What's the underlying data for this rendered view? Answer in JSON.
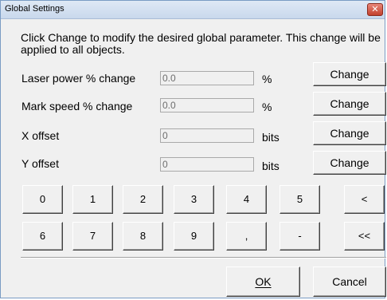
{
  "window": {
    "title": "Global Settings",
    "close_symbol": "✕"
  },
  "instructions": "Click Change to modify the desired global parameter. This change will be applied to all objects.",
  "parameters": [
    {
      "label": "Laser power % change",
      "value": "0.0",
      "unit": "%",
      "button": "Change"
    },
    {
      "label": "Mark speed % change",
      "value": "0.0",
      "unit": "%",
      "button": "Change"
    },
    {
      "label": "X offset",
      "value": "0",
      "unit": "bits",
      "button": "Change"
    },
    {
      "label": "Y offset",
      "value": "0",
      "unit": "bits",
      "button": "Change"
    }
  ],
  "keypad": {
    "row1": [
      "0",
      "1",
      "2",
      "3",
      "4",
      "5",
      "<"
    ],
    "row2": [
      "6",
      "7",
      "8",
      "9",
      ",",
      "-",
      "<<"
    ]
  },
  "footer": {
    "ok": "OK",
    "cancel": "Cancel"
  }
}
